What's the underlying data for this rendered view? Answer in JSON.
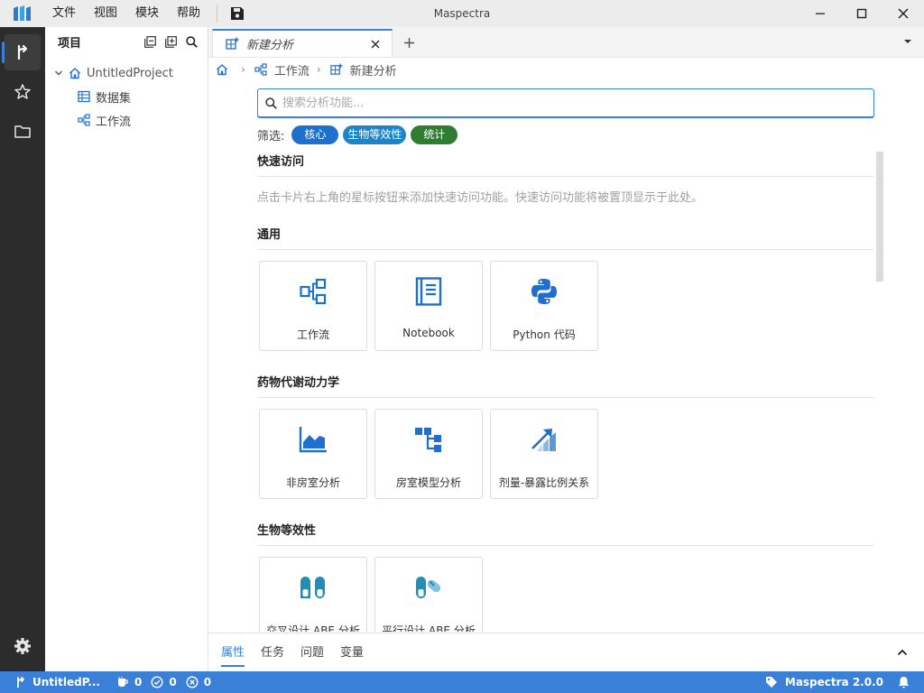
{
  "window": {
    "title": "Maspectra",
    "menu": [
      "文件",
      "视图",
      "模块",
      "帮助"
    ]
  },
  "sidebar": {
    "title": "项目",
    "tree": {
      "root": "UntitledProject",
      "children": [
        "数据集",
        "工作流"
      ]
    }
  },
  "editor": {
    "tab_label": "新建分析",
    "breadcrumb": [
      "工作流",
      "新建分析"
    ],
    "search_placeholder": "搜索分析功能...",
    "filter_label": "筛选:",
    "filters": [
      {
        "label": "核心",
        "color": "#1f6fcc"
      },
      {
        "label": "生物等效性",
        "color": "#1e84c8"
      },
      {
        "label": "统计",
        "color": "#2e7d32"
      }
    ],
    "sections": {
      "quick": {
        "title": "快速访问",
        "hint": "点击卡片右上角的星标按钮来添加快速访问功能。快速访问功能将被置顶显示于此处。"
      },
      "general": {
        "title": "通用",
        "cards": [
          "工作流",
          "Notebook",
          "Python 代码"
        ]
      },
      "pk": {
        "title": "药物代谢动力学",
        "cards": [
          "非房室分析",
          "房室模型分析",
          "剂量-暴露比例关系"
        ]
      },
      "be": {
        "title": "生物等效性",
        "cards": [
          "交叉设计 ABE 分析",
          "平行设计 ABE 分析"
        ]
      }
    }
  },
  "panel": {
    "tabs": [
      "属性",
      "任务",
      "问题",
      "变量"
    ]
  },
  "statusbar": {
    "project": "UntitledP...",
    "counts": [
      "0",
      "0",
      "0"
    ],
    "version": "Maspectra 2.0.0"
  },
  "colors": {
    "accent": "#3a80d9",
    "activity_bg": "#2c2c2c",
    "icon_blue": "#1f6fcc"
  }
}
